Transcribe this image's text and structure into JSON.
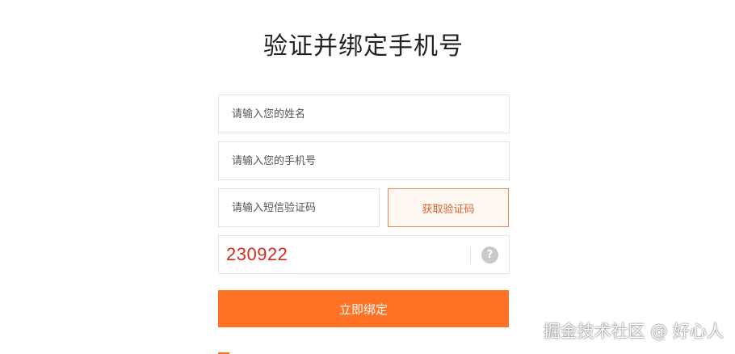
{
  "page_title": "验证并绑定手机号",
  "form": {
    "name_placeholder": "请输入您的姓名",
    "phone_placeholder": "请输入您的手机号",
    "sms_placeholder": "请输入短信验证码",
    "get_code_label": "获取验证码",
    "captcha_code": "230922",
    "help_icon_glyph": "?",
    "submit_label": "立即绑定"
  },
  "colors": {
    "accent": "#ff7125",
    "accent_border": "#e98550",
    "captcha_text": "#d62a1f"
  },
  "icons": [
    "question-circle-icon"
  ],
  "watermark": "掘金技术社区 @ 好心人"
}
